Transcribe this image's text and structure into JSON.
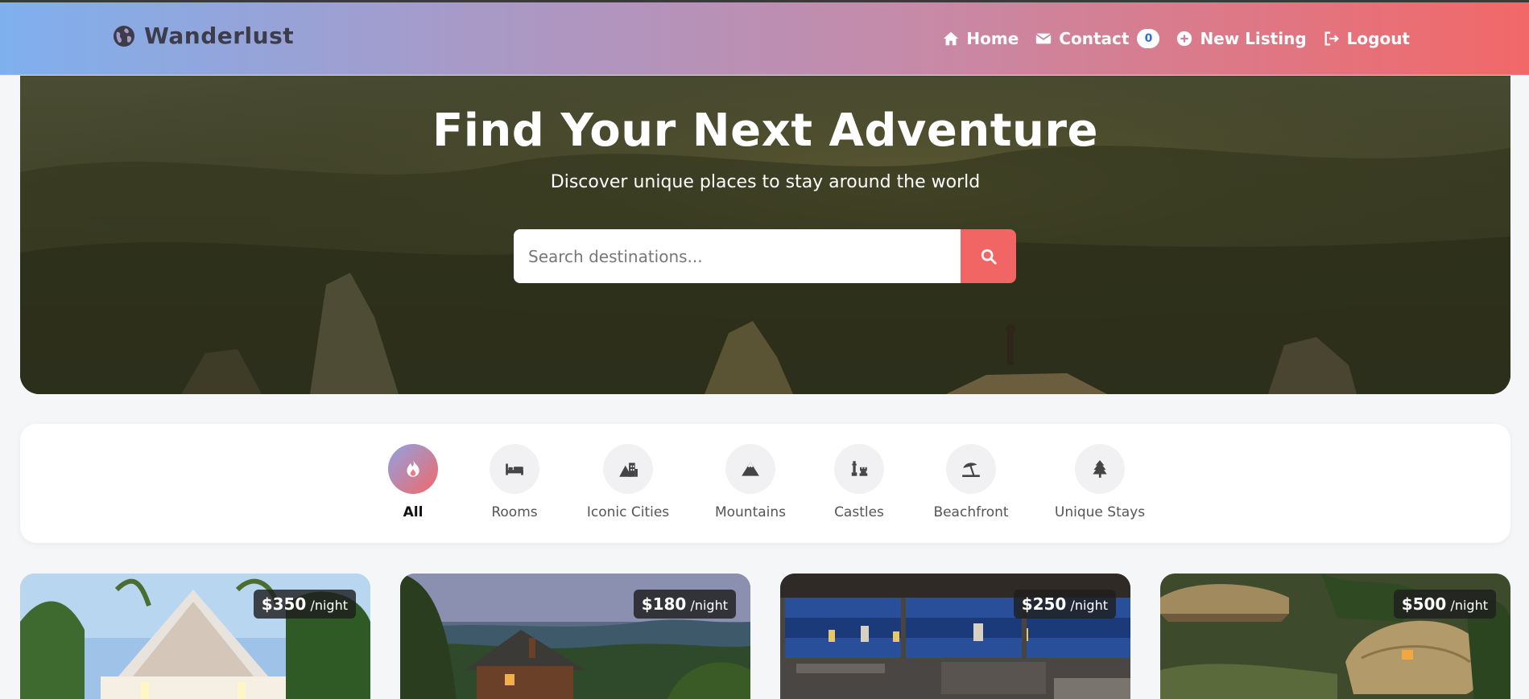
{
  "brand": {
    "name": "Wanderlust",
    "icon": "globe-icon"
  },
  "nav": {
    "home": "Home",
    "contact": "Contact",
    "contact_badge": "0",
    "new_listing": "New Listing",
    "logout": "Logout"
  },
  "hero": {
    "title": "Find Your Next Adventure",
    "subtitle": "Discover unique places to stay around the world",
    "search_placeholder": "Search destinations..."
  },
  "categories": [
    {
      "label": "All",
      "icon": "fire-icon",
      "active": true
    },
    {
      "label": "Rooms",
      "icon": "bed-icon"
    },
    {
      "label": "Iconic Cities",
      "icon": "city-icon"
    },
    {
      "label": "Mountains",
      "icon": "mountain-icon"
    },
    {
      "label": "Castles",
      "icon": "chess-castle-icon"
    },
    {
      "label": "Beachfront",
      "icon": "umbrella-beach-icon"
    },
    {
      "label": "Unique Stays",
      "icon": "tree-icon"
    }
  ],
  "listings": [
    {
      "price": "$350",
      "per": "/night"
    },
    {
      "price": "$180",
      "per": "/night"
    },
    {
      "price": "$250",
      "per": "/night"
    },
    {
      "price": "$500",
      "per": "/night"
    }
  ],
  "colors": {
    "accent": "#f26565",
    "nav_start": "#7fb0ee",
    "nav_end": "#f26868"
  }
}
